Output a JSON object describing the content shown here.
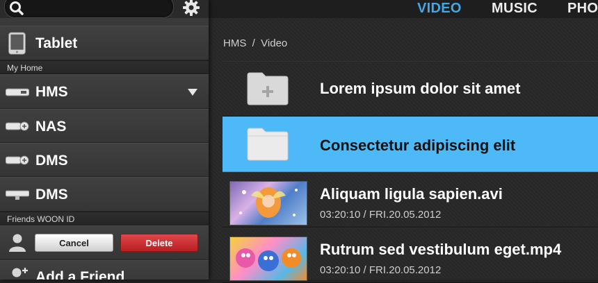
{
  "sidebar": {
    "device_name": "Tablet",
    "section_home": "My Home",
    "devices": [
      {
        "label": "HMS"
      },
      {
        "label": "NAS"
      },
      {
        "label": "DMS"
      },
      {
        "label": "DMS"
      }
    ],
    "section_friends": "Friends WOON ID",
    "cancel_label": "Cancel",
    "delete_label": "Delete",
    "add_friend_label": "Add a Friend"
  },
  "nav": {
    "tabs": [
      {
        "label": "VIDEO",
        "active": true
      },
      {
        "label": "MUSIC",
        "active": false
      },
      {
        "label": "PHOTO",
        "active": false
      }
    ]
  },
  "content": {
    "breadcrumb": "HMS  /  Video",
    "items": [
      {
        "title": "Lorem ipsum dolor sit amet",
        "kind": "add-folder"
      },
      {
        "title": "Consectetur adipiscing elit",
        "kind": "folder",
        "selected": true
      },
      {
        "title": "Aliquam ligula sapien.avi",
        "meta": "03:20:10 / FRI.20.05.2012",
        "kind": "video"
      },
      {
        "title": "Rutrum sed vestibulum eget.mp4",
        "meta": "03:20:10 / FRI.20.05.2012",
        "kind": "video"
      }
    ]
  },
  "colors": {
    "accent": "#3fa9e8",
    "selected_row": "#4dbaf7",
    "delete": "#c8262a"
  }
}
